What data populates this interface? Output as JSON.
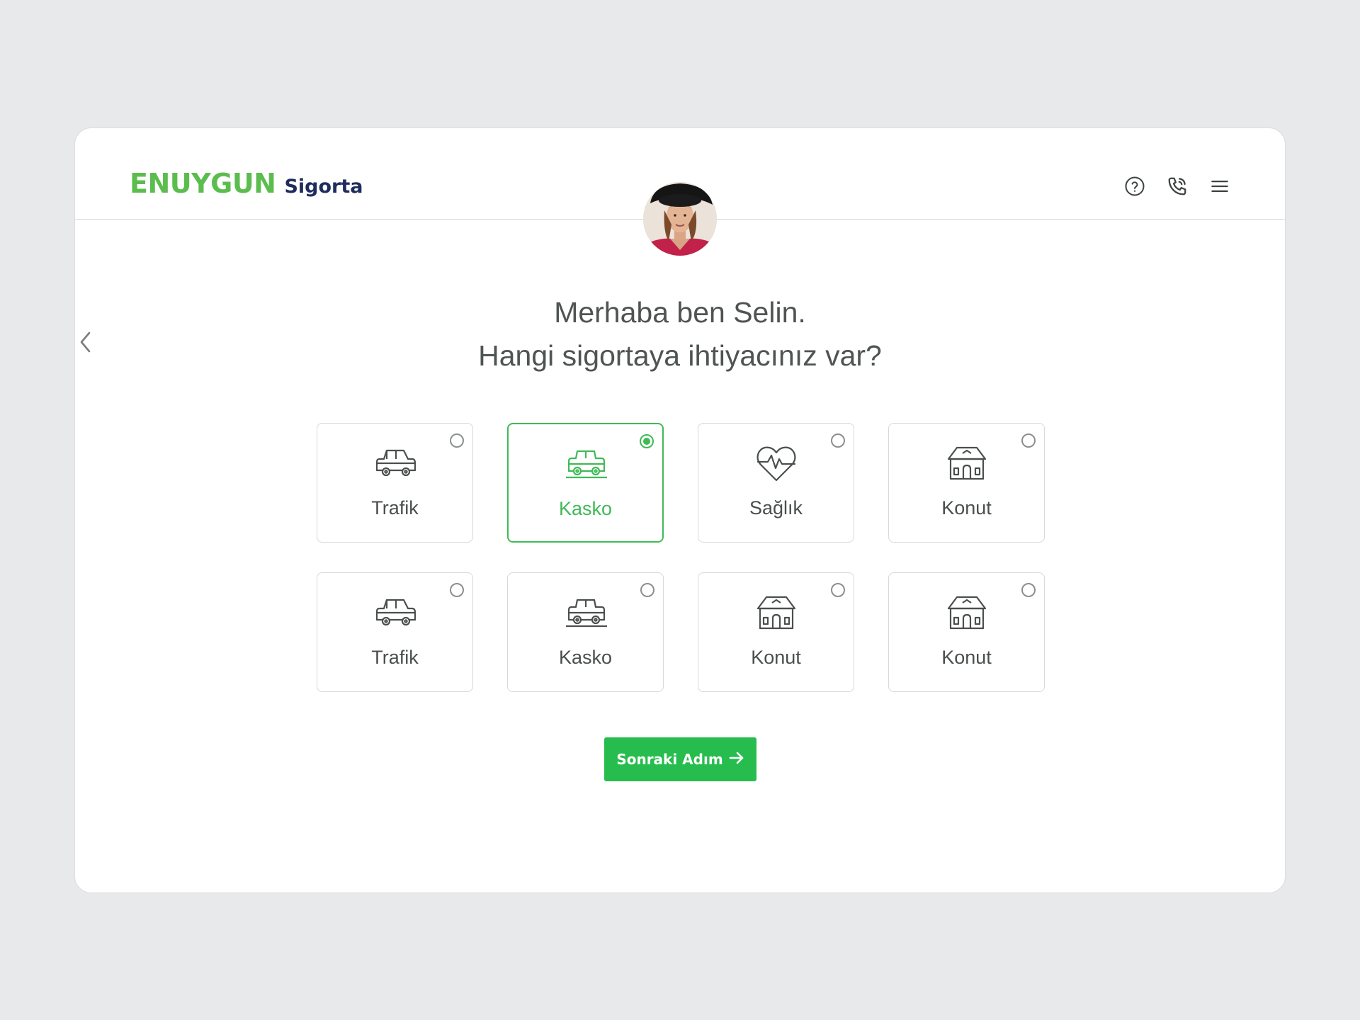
{
  "brand": {
    "name": "ENUYGUN",
    "product": "Sigorta",
    "green": "#5cbd4f",
    "navy": "#1f2c5c"
  },
  "header": {
    "icons": [
      "help-circle-icon",
      "phone-call-icon",
      "hamburger-menu-icon"
    ]
  },
  "assistant": {
    "avatar": "assistant-avatar-photo"
  },
  "greeting": {
    "line1": "Merhaba ben Selin.",
    "line2": "Hangi sigortaya ihtiyacınız var?"
  },
  "options": [
    {
      "label": "Trafik",
      "icon": "car-icon",
      "selected": false
    },
    {
      "label": "Kasko",
      "icon": "car-icon",
      "selected": true
    },
    {
      "label": "Sağlık",
      "icon": "heart-pulse-icon",
      "selected": false
    },
    {
      "label": "Konut",
      "icon": "house-icon",
      "selected": false
    },
    {
      "label": "Trafik",
      "icon": "car-icon",
      "selected": false
    },
    {
      "label": "Kasko",
      "icon": "car-icon",
      "selected": false
    },
    {
      "label": "Konut",
      "icon": "house-icon",
      "selected": false
    },
    {
      "label": "Konut",
      "icon": "house-icon",
      "selected": false
    }
  ],
  "next_button": {
    "label": "Sonraki Adım",
    "icon": "arrow-right-icon",
    "color": "#27bd4e"
  },
  "colors": {
    "accent": "#3fba56",
    "text": "#4f5453",
    "background": "#e8e9eb"
  }
}
